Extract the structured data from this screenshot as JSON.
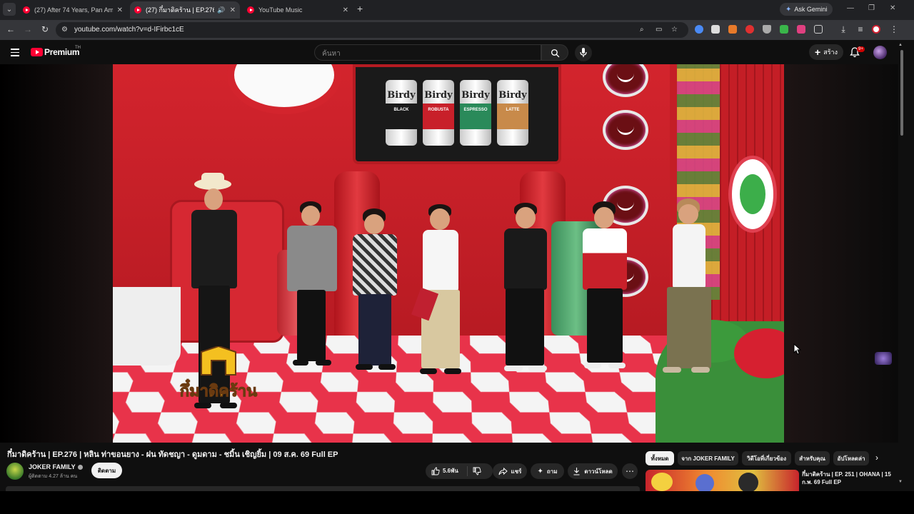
{
  "browser": {
    "tabs": [
      {
        "title": "(27) After 74 Years, Pan Am Wa",
        "active": false
      },
      {
        "title": "(27) กึ๋มาดิคร้าน | EP.276 | หลิ",
        "active": true
      },
      {
        "title": "YouTube Music",
        "active": false
      }
    ],
    "ask_gemini": "Ask Gemini",
    "url": "youtube.com/watch?v=d-IFirbc1cE"
  },
  "youtube": {
    "brand": "Premium",
    "country_code": "TH",
    "search_placeholder": "ค้นหา",
    "create_label": "สร้าง",
    "notification_count": "9+"
  },
  "video": {
    "title": "กึ๋มาดิคร้าน | EP.276 | หลิน ท่าขอนยาง - ฝน ทัดชญา - ดูมดาม - ชมิ้น เชิญยิ้ม | 09 ส.ค. 69 Full EP",
    "channel_name": "JOKER FAMILY",
    "subscribers": "ผู้ติดตาม 4.27 ล้าน คน",
    "subscribe_label": "ติดตาม",
    "likes": "5.6พัน",
    "share_label": "แชร์",
    "ask_label": "ถาม",
    "download_label": "ดาวน์โหลด",
    "overlay_logo": "กึ๋มาดิคร้าน",
    "can_brand": "Birdy",
    "cans": [
      "BLACK",
      "ROBUSTA",
      "ESPRESSO",
      "LATTE"
    ]
  },
  "sidebar": {
    "chips": [
      "ทั้งหมด",
      "จาก JOKER FAMILY",
      "วิดีโอที่เกี่ยวข้อง",
      "สำหรับคุณ",
      "อัปโหลดล่า"
    ],
    "recommendation_title": "กึ๋มาดิคร้าน | EP. 251 | OHANA | 15 ก.พ. 69 Full EP"
  },
  "colors": {
    "youtube_red": "#ff0033",
    "page_bg": "#0f0f0f",
    "pill_bg": "#272727"
  }
}
